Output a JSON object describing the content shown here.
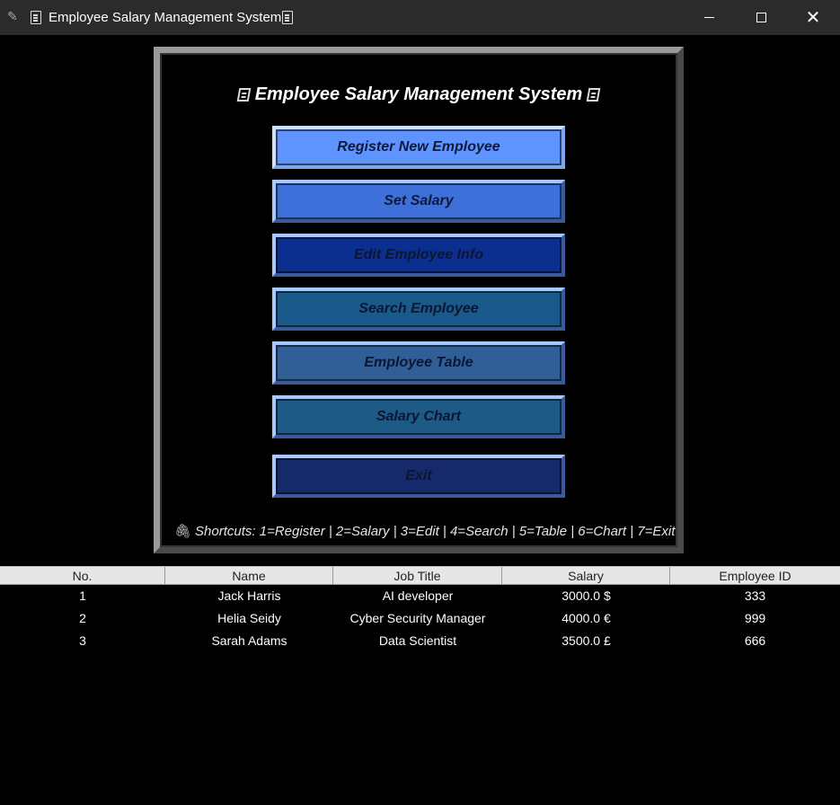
{
  "window": {
    "title": "Employee Salary Management System",
    "icons": [
      "feather-icon",
      "ledger-icon",
      "ledger-icon"
    ],
    "controls": {
      "minimize": "minimize",
      "maximize": "maximize",
      "close": "✕"
    }
  },
  "panel": {
    "heading": "Employee Salary Management System",
    "buttons": [
      {
        "label": "Register New Employee",
        "bg": "#5f93ff",
        "text_color": "#0d1a3a"
      },
      {
        "label": "Set Salary",
        "bg": "#3f6fd8",
        "text_color": "#0d1a3a"
      },
      {
        "label": "Edit Employee Info",
        "bg": "#0a2f8f",
        "text_color": "#0b1633"
      },
      {
        "label": "Search Employee",
        "bg": "#1a5a8a",
        "text_color": "#0b1633"
      },
      {
        "label": "Employee Table",
        "bg": "#2f5f96",
        "text_color": "#0b1633"
      },
      {
        "label": "Salary Chart",
        "bg": "#1d5a86",
        "text_color": "#0b1633"
      },
      {
        "label": "Exit",
        "bg": "#16296b",
        "text_color": "#0b1633"
      }
    ],
    "shortcuts": "Shortcuts: 1=Register | 2=Salary | 3=Edit | 4=Search | 5=Table | 6=Chart | 7=Exit"
  },
  "table": {
    "columns": [
      "No.",
      "Name",
      "Job Title",
      "Salary",
      "Employee ID"
    ],
    "rows": [
      [
        "1",
        "Jack Harris",
        "AI developer",
        "3000.0 $",
        "333"
      ],
      [
        "2",
        "Helia Seidy",
        "Cyber Security Manager",
        "4000.0 €",
        "999"
      ],
      [
        "3",
        "Sarah Adams",
        "Data Scientist",
        "3500.0 £",
        "666"
      ]
    ]
  }
}
